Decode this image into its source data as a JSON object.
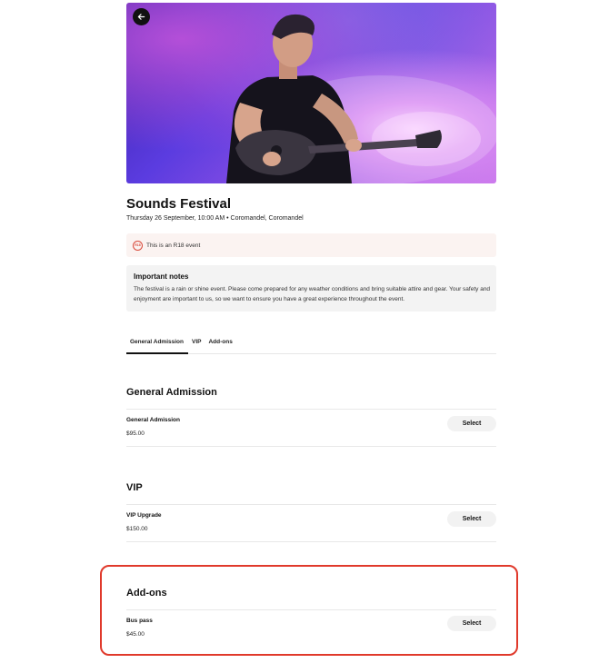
{
  "hero": {
    "back_icon": "arrow-left-icon",
    "image_description_colors": [
      "#3a1fa8",
      "#8a4fe3",
      "#f6c8ff"
    ]
  },
  "event": {
    "title": "Sounds Festival",
    "subtitle": "Thursday 26 September, 10:00 AM • Coromandel, Coromandel"
  },
  "age_notice": {
    "badge": "R18",
    "text": "This is an R18 event"
  },
  "notes": {
    "title": "Important notes",
    "body": "The festival is a rain or shine event. Please come prepared for any weather conditions and bring suitable attire and gear. Your safety and enjoyment are important to us, so we want to ensure you have a great experience throughout the event."
  },
  "tabs": [
    {
      "label": "General Admission",
      "active": true
    },
    {
      "label": "VIP",
      "active": false
    },
    {
      "label": "Add-ons",
      "active": false
    }
  ],
  "sections": [
    {
      "heading": "General Admission",
      "tickets": [
        {
          "name": "General Admission",
          "price": "$95.00",
          "button": "Select"
        }
      ]
    },
    {
      "heading": "VIP",
      "tickets": [
        {
          "name": "VIP Upgrade",
          "price": "$150.00",
          "button": "Select"
        }
      ]
    },
    {
      "heading": "Add-ons",
      "tickets": [
        {
          "name": "Bus pass",
          "price": "$45.00",
          "button": "Select"
        }
      ]
    }
  ],
  "colors": {
    "highlight": "#e0392b",
    "accent_red": "#d9493a",
    "notice_bg": "#fbf3f1",
    "notes_bg": "#f3f3f3"
  }
}
